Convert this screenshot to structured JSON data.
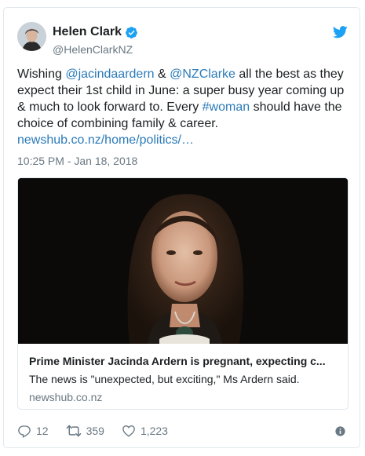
{
  "user": {
    "name": "Helen Clark",
    "handle": "@HelenClarkNZ"
  },
  "tweet": {
    "t1": "Wishing ",
    "mention1": "@jacindaardern",
    "t2": " & ",
    "mention2": "@NZClarke",
    "t3": " all the best as they expect their 1st child in June: a super busy year coming up & much to look forward to. Every ",
    "hashtag": "#woman",
    "t4": " should have the choice of combining family & career.",
    "url": "newshub.co.nz/home/politics/…",
    "timestamp": "10:25 PM - Jan 18, 2018"
  },
  "card": {
    "title": "Prime Minister Jacinda Ardern is pregnant, expecting c...",
    "description": "The news is \"unexpected, but exciting,\" Ms Ardern said.",
    "domain": "newshub.co.nz"
  },
  "actions": {
    "replies": "12",
    "retweets": "359",
    "likes": "1,223"
  },
  "icons": [
    "verified-badge-icon",
    "twitter-bird-icon",
    "reply-icon",
    "retweet-icon",
    "like-icon",
    "info-icon"
  ],
  "colors": {
    "link": "#2b7bb9",
    "twitter_blue": "#1da1f2",
    "muted": "#697882",
    "border": "#e1e8ed"
  }
}
